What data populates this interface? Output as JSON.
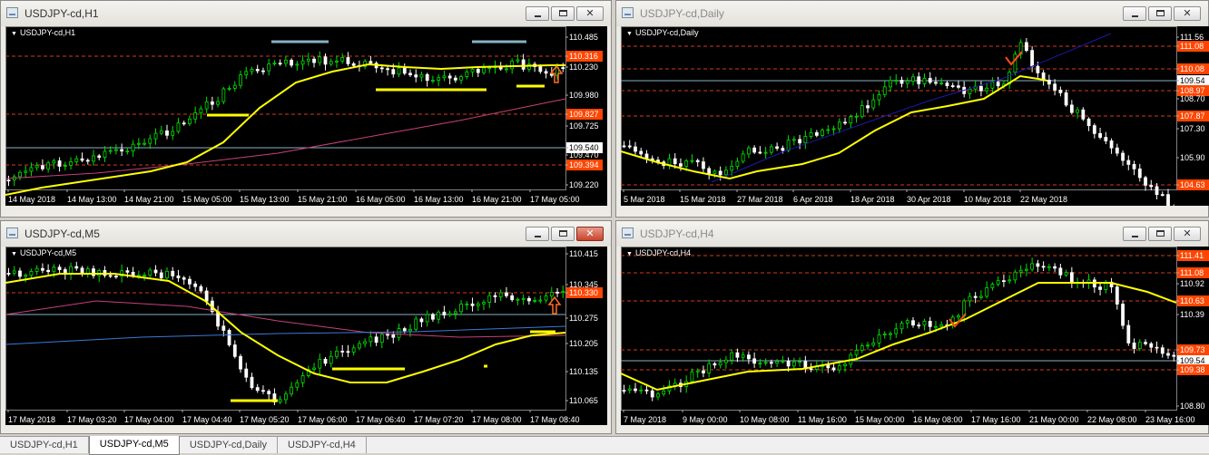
{
  "windows": [
    {
      "key": "h1",
      "title": "USDJPY-cd,H1",
      "symbol": "USDJPY-cd,H1",
      "prices": [
        "110.485",
        "110.316",
        "110.230",
        "109.980",
        "109.827",
        "109.725",
        "109.540",
        "109.470",
        "109.394",
        "109.220"
      ],
      "dates": [
        "14 May 2018",
        "14 May 13:00",
        "14 May 21:00",
        "15 May 05:00",
        "15 May 13:00",
        "15 May 21:00",
        "16 May 05:00",
        "16 May 13:00",
        "16 May 21:00",
        "17 May 05:00"
      ]
    },
    {
      "key": "daily",
      "title": "USDJPY-cd,Daily",
      "symbol": "USDJPY-cd,Daily",
      "prices": [
        "111.56",
        "111.08",
        "110.08",
        "109.54",
        "108.97",
        "108.70",
        "107.87",
        "107.30",
        "105.90",
        "104.63"
      ],
      "dates": [
        "5 Mar 2018",
        "15 Mar 2018",
        "27 Mar 2018",
        "6 Apr 2018",
        "18 Apr 2018",
        "30 Apr 2018",
        "10 May 2018",
        "22 May 2018"
      ]
    },
    {
      "key": "m5",
      "title": "USDJPY-cd,M5",
      "symbol": "USDJPY-cd,M5",
      "prices": [
        "110.415",
        "110.345",
        "110.330",
        "110.275",
        "110.205",
        "110.135",
        "110.065"
      ],
      "dates": [
        "17 May 2018",
        "17 May 03:20",
        "17 May 04:00",
        "17 May 04:40",
        "17 May 05:20",
        "17 May 06:00",
        "17 May 06:40",
        "17 May 07:20",
        "17 May 08:00",
        "17 May 08:40"
      ]
    },
    {
      "key": "h4",
      "title": "USDJPY-cd,H4",
      "symbol": "USDJPY-cd,H4",
      "prices": [
        "111.41",
        "111.08",
        "110.92",
        "110.63",
        "110.39",
        "109.73",
        "109.54",
        "109.38",
        "108.80"
      ],
      "dates": [
        "7 May 2018",
        "9 May 00:00",
        "10 May 08:00",
        "11 May 16:00",
        "15 May 00:00",
        "16 May 08:00",
        "17 May 16:00",
        "21 May 00:00",
        "22 May 08:00",
        "23 May 16:00"
      ]
    }
  ],
  "tabs": [
    "USDJPY-cd,H1",
    "USDJPY-cd,M5",
    "USDJPY-cd,Daily",
    "USDJPY-cd,H4"
  ],
  "colors": {
    "bull": "#00e000",
    "bear": "#ffffff",
    "ma_fast": "#ffff00",
    "ma_slow": "#c8407a",
    "bid": "#87b1c4",
    "level_line": "#d43a1a",
    "price_label": "#ff4500",
    "trend": "#1a1aa8",
    "arrow": "#ff6a2a"
  },
  "icons": {
    "window": "chart-window-icon",
    "minimize": "minimize-icon",
    "maximize": "maximize-icon",
    "close": "close-icon"
  }
}
